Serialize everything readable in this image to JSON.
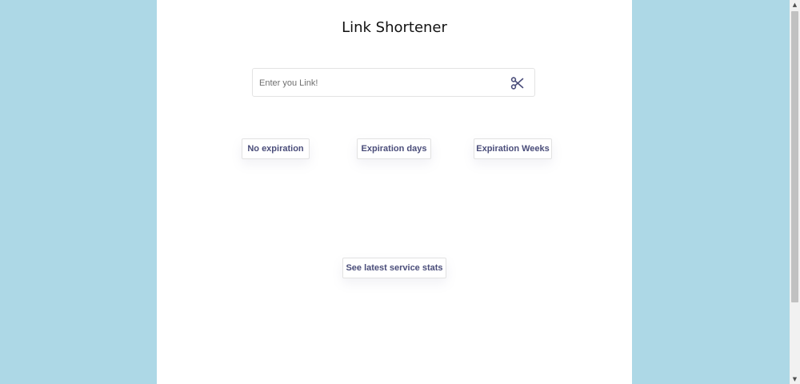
{
  "app": {
    "title": "Link Shortener"
  },
  "search": {
    "placeholder": "Enter you Link!",
    "value": "",
    "action_icon": "scissors-icon"
  },
  "expiration_options": {
    "no_expiration": "No expiration",
    "days": "Expiration days",
    "weeks": "Expiration Weeks"
  },
  "stats": {
    "label": "See latest service stats"
  },
  "scrollbar": {
    "up_glyph": "▲",
    "down_glyph": "▼"
  },
  "colors": {
    "background": "#add8e6",
    "accent": "#4a4d7a"
  }
}
